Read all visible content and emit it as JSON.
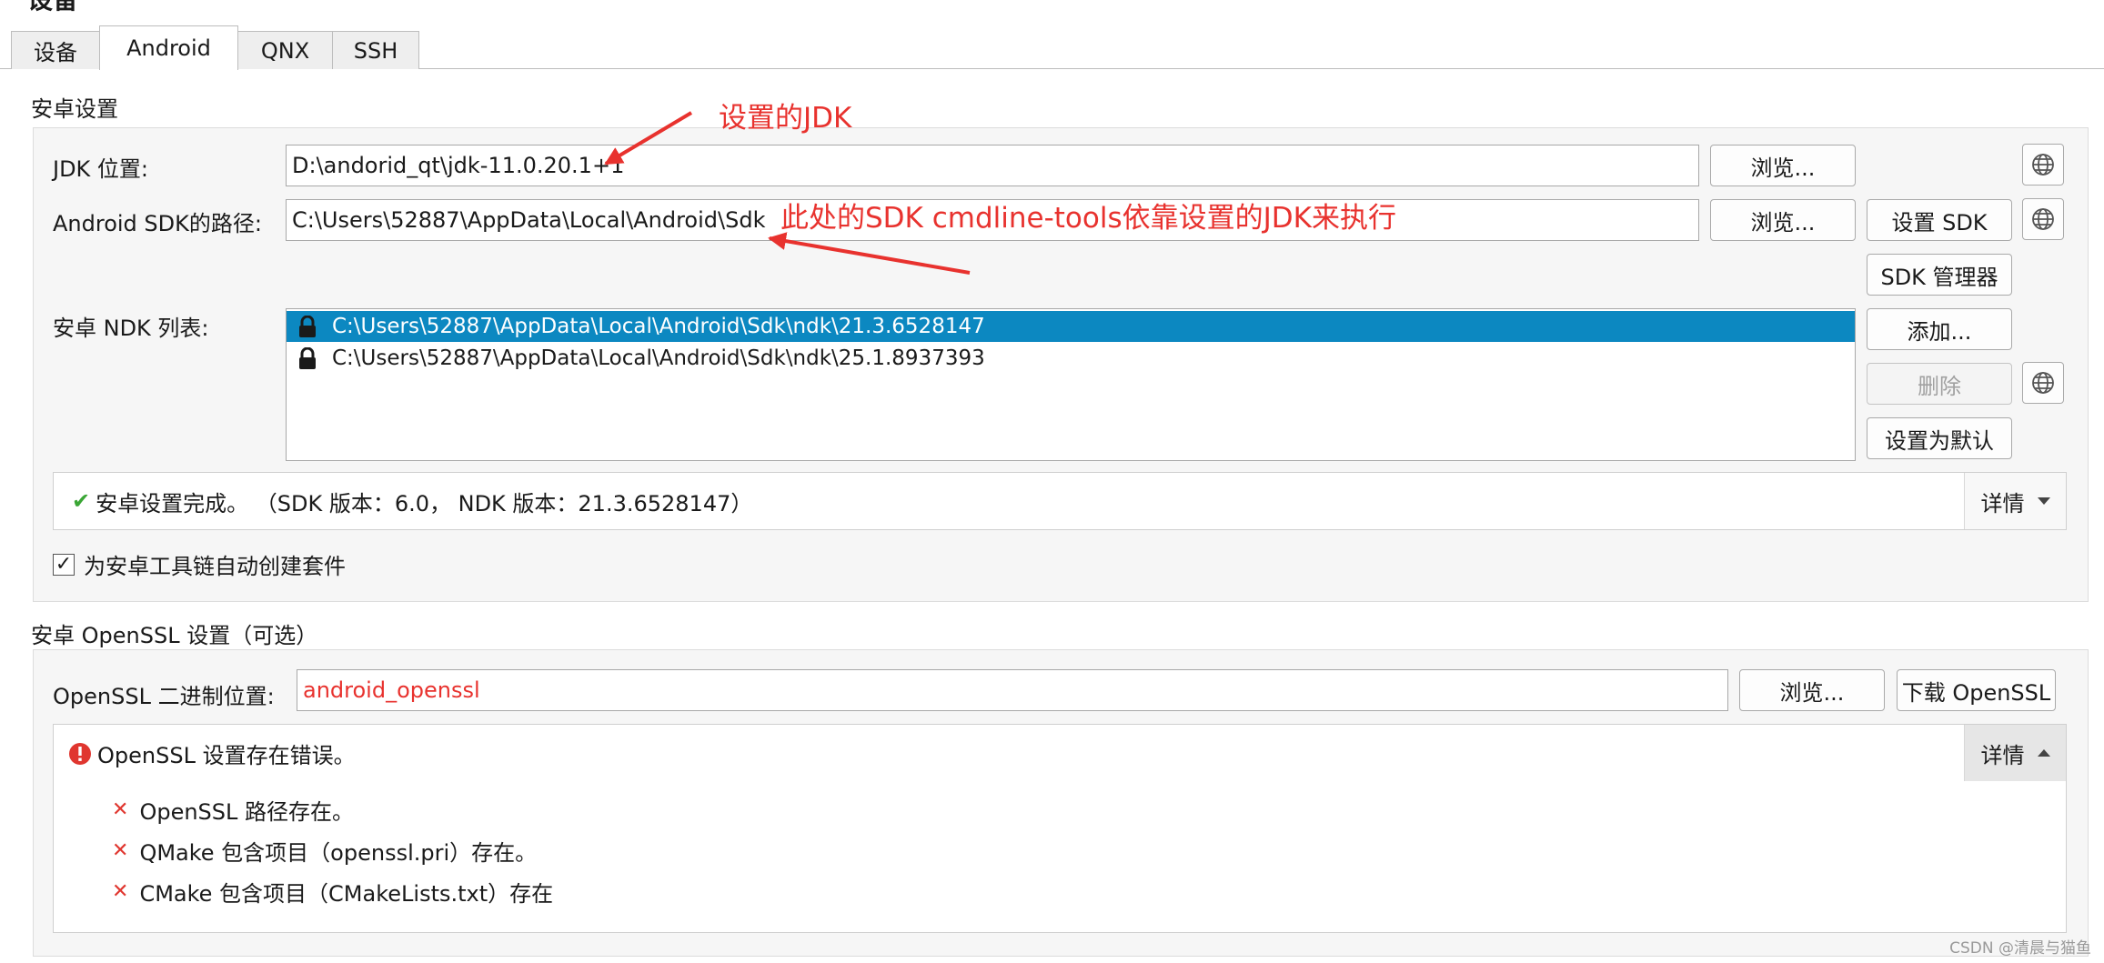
{
  "page_heading": "设备",
  "tabs": [
    {
      "label": "设备",
      "active": false
    },
    {
      "label": "Android",
      "active": true
    },
    {
      "label": "QNX",
      "active": false
    },
    {
      "label": "SSH",
      "active": false
    }
  ],
  "android": {
    "section_title": "安卓设置",
    "jdk": {
      "label": "JDK 位置:",
      "value": "D:\\andorid_qt\\jdk-11.0.20.1+1",
      "browse": "浏览..."
    },
    "sdk": {
      "label": "Android SDK的路径:",
      "value": "C:\\Users\\52887\\AppData\\Local\\Android\\Sdk",
      "browse": "浏览...",
      "setup": "设置 SDK",
      "manager": "SDK 管理器"
    },
    "ndk": {
      "label": "安卓 NDK 列表:",
      "items": [
        "C:\\Users\\52887\\AppData\\Local\\Android\\Sdk\\ndk\\21.3.6528147",
        "C:\\Users\\52887\\AppData\\Local\\Android\\Sdk\\ndk\\25.1.8937393"
      ],
      "add": "添加...",
      "remove": "删除",
      "set_default": "设置为默认"
    },
    "status": {
      "check": "✔",
      "text": "安卓设置完成。 （SDK 版本：6.0， NDK 版本：21.3.6528147）",
      "details": "详情"
    },
    "auto_create": {
      "checked": true,
      "mark": "✓",
      "label": "为安卓工具链自动创建套件"
    }
  },
  "openssl": {
    "section_title": "安卓 OpenSSL 设置（可选）",
    "label": "OpenSSL 二进制位置:",
    "value": "android_openssl",
    "browse": "浏览...",
    "download": "下载 OpenSSL",
    "error": {
      "title": "OpenSSL 设置存在错误。",
      "details": "详情",
      "items": [
        "OpenSSL 路径存在。",
        "QMake 包含项目（openssl.pri）存在。",
        "CMake 包含项目（CMakeLists.txt）存在"
      ]
    }
  },
  "annotations": {
    "jdk_note": "设置的JDK",
    "sdk_note": "此处的SDK cmdline-tools依靠设置的JDK来执行",
    "color": "#e8322e"
  },
  "watermark": "CSDN @清晨与猫鱼",
  "colors": {
    "selection": "#0c88c1",
    "error_red": "#e0362f",
    "ok_green": "#3aa635"
  }
}
